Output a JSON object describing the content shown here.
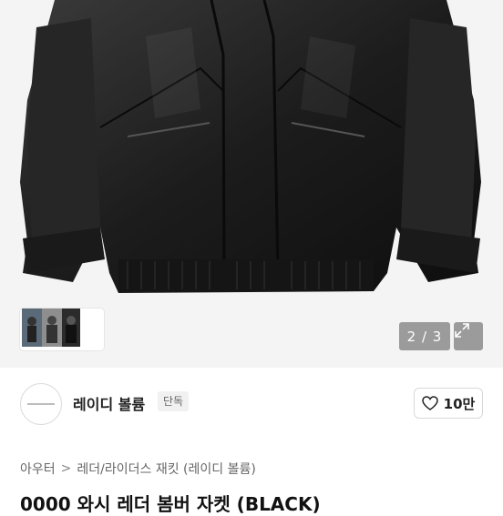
{
  "gallery": {
    "counter": "2 / 3",
    "alt": "black leather bomber jacket"
  },
  "icons": {
    "thumb_next": "chevron-right-icon",
    "expand": "expand-icon",
    "like": "heart-icon"
  },
  "seller": {
    "name": "레이디 볼륨",
    "badge": "단독",
    "likes": "10만"
  },
  "breadcrumb": {
    "items": [
      "아우터",
      "레더/라이더스 재킷 (레이디 볼륨)"
    ],
    "separator": ">"
  },
  "product": {
    "title": "0000 와시 레더 봄버 자켓 (BLACK)"
  },
  "colors": {
    "counter_bg": "#787878",
    "hero_bg": "#f4f4f4",
    "text": "#222222"
  }
}
